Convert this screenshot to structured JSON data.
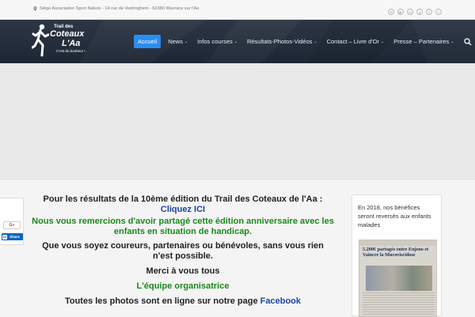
{
  "topbar": {
    "address": "Siège Association Sport Nature - 14 rue de Vedringhem - 62380 Wavrans sur l'Aa",
    "socials": [
      "email-icon",
      "youtube-icon",
      "instagram-icon",
      "google-plus-icon",
      "twitter-icon",
      "facebook-icon"
    ]
  },
  "logo": {
    "line1": "Trail des",
    "line2": "Coteaux",
    "line3": "L'Aa",
    "tagline": "C'est du bonheur !"
  },
  "nav": {
    "items": [
      {
        "label": "Accueil",
        "active": true
      },
      {
        "label": "News",
        "dropdown": true
      },
      {
        "label": "Infos courses",
        "dropdown": true
      },
      {
        "label": "Résultats-Photos-Vidéos",
        "dropdown": true
      },
      {
        "label": "Contact – Livre d'Or",
        "dropdown": true
      },
      {
        "label": "Presse – Partenaires",
        "dropdown": true
      }
    ]
  },
  "main": {
    "p1_text": "Pour les résultats de la 10ème édition du Trail des Coteaux de l'Aa : ",
    "p1_link": "Cliquez ICI",
    "p2": "Nous vous remercions d'avoir partagé cette édition anniversaire avec les enfants en situation de handicap.",
    "p3": "Que vous soyez coureurs, partenaires ou bénévoles, sans vous rien n'est possible.",
    "p4": "Merci à vous tous",
    "p5": "L'équipe organisatrice",
    "p6_text": "Toutes les photos sont en ligne sur notre page ",
    "p6_link": "Facebook"
  },
  "sidebar": {
    "text": "En 2018, nos bénéfices seront reversés aux enfants malades",
    "clipping_headline": "5.200€ partagés entre Enjeno et Vaincre la Mucoviscidose"
  },
  "share": {
    "google_label": "G+",
    "linkedin_label": "Share",
    "linkedin_glyph": "in"
  },
  "colors": {
    "accent": "#2a8ef0",
    "header_bg": "#222c3a",
    "green_text": "#1a8a1a",
    "link": "#1a45a8"
  }
}
